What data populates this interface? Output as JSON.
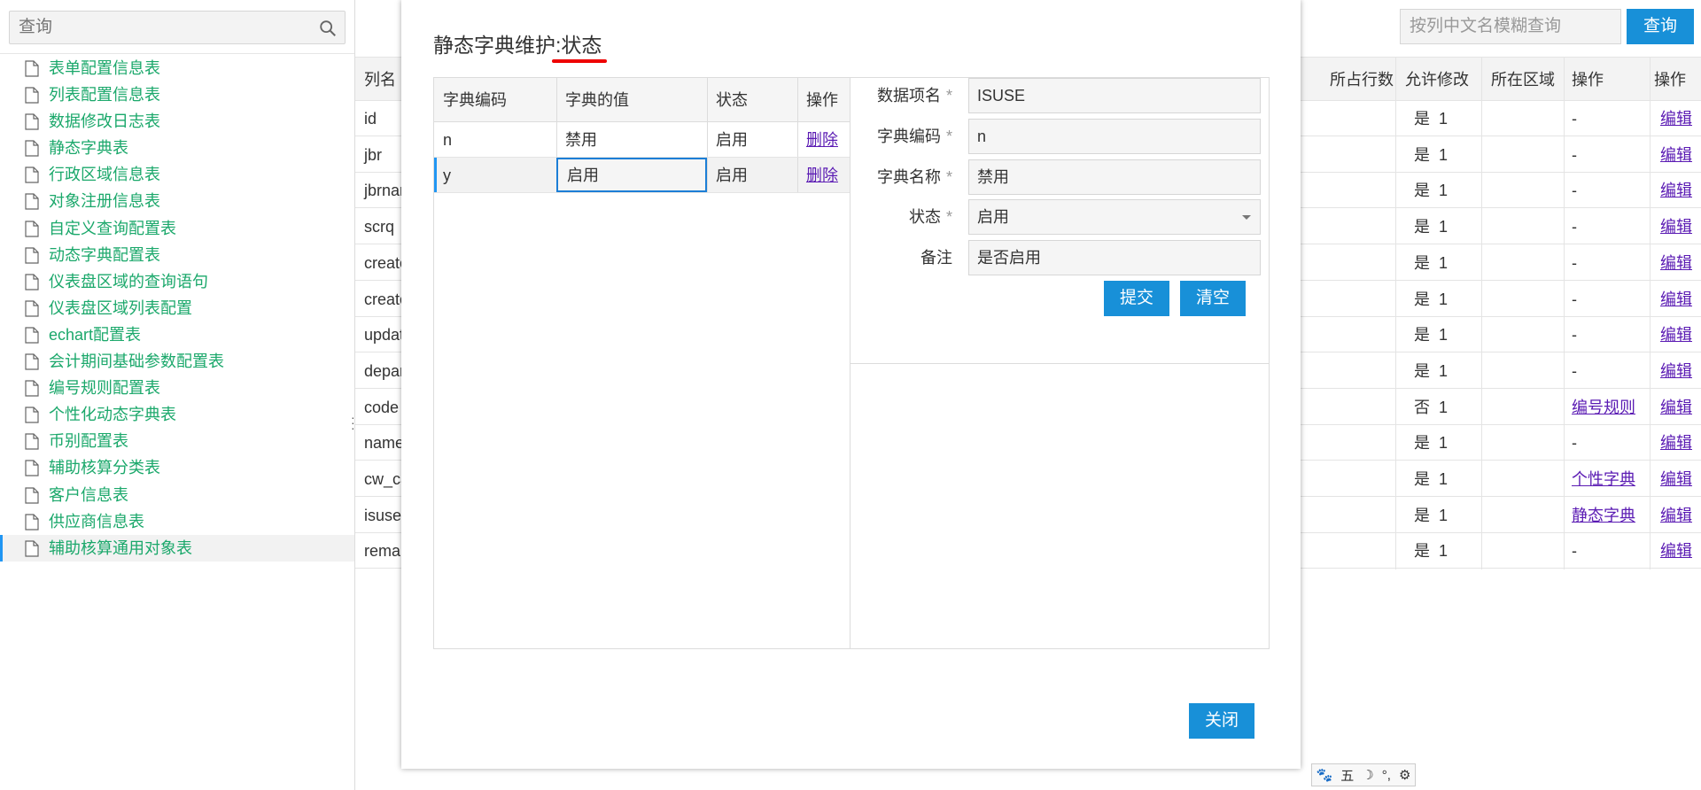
{
  "sidebar": {
    "search_placeholder": "查询",
    "items": [
      {
        "label": "表单配置信息表"
      },
      {
        "label": "列表配置信息表"
      },
      {
        "label": "数据修改日志表"
      },
      {
        "label": "静态字典表"
      },
      {
        "label": "行政区域信息表"
      },
      {
        "label": "对象注册信息表"
      },
      {
        "label": "自定义查询配置表"
      },
      {
        "label": "动态字典配置表"
      },
      {
        "label": "仪表盘区域的查询语句"
      },
      {
        "label": "仪表盘区域列表配置"
      },
      {
        "label": "echart配置表"
      },
      {
        "label": "会计期间基础参数配置表"
      },
      {
        "label": "编号规则配置表"
      },
      {
        "label": "个性化动态字典表"
      },
      {
        "label": "币别配置表"
      },
      {
        "label": "辅助核算分类表"
      },
      {
        "label": "客户信息表"
      },
      {
        "label": "供应商信息表"
      },
      {
        "label": "辅助核算通用对象表"
      }
    ],
    "selected_index": 18
  },
  "main": {
    "search_placeholder": "按列中文名模糊查询",
    "search_button": "查询",
    "headers": {
      "col_name": "列名",
      "rows": "所占行数",
      "editable": "允许修改",
      "area": "所在区域",
      "op": "操作",
      "op2": "操作"
    },
    "rows": [
      {
        "name": "id",
        "rows": "1",
        "editable": "是",
        "op": "-",
        "edit": "编辑"
      },
      {
        "name": "jbr",
        "rows": "1",
        "editable": "是",
        "op": "-",
        "edit": "编辑"
      },
      {
        "name": "jbrnar",
        "rows": "1",
        "editable": "是",
        "op": "-",
        "edit": "编辑"
      },
      {
        "name": "scrq",
        "rows": "1",
        "editable": "是",
        "op": "-",
        "edit": "编辑"
      },
      {
        "name": "creato",
        "rows": "1",
        "editable": "是",
        "op": "-",
        "edit": "编辑"
      },
      {
        "name": "creato",
        "rows": "1",
        "editable": "是",
        "op": "-",
        "edit": "编辑"
      },
      {
        "name": "updat",
        "rows": "1",
        "editable": "是",
        "op": "-",
        "edit": "编辑"
      },
      {
        "name": "depar",
        "rows": "1",
        "editable": "是",
        "op": "-",
        "edit": "编辑"
      },
      {
        "name": "code",
        "rows": "1",
        "editable": "否",
        "op": "编号规则",
        "edit": "编辑"
      },
      {
        "name": "name",
        "rows": "1",
        "editable": "是",
        "op": "-",
        "edit": "编辑"
      },
      {
        "name": "cw_ca",
        "rows": "1",
        "editable": "是",
        "op": "个性字典",
        "edit": "编辑"
      },
      {
        "name": "isuse",
        "rows": "1",
        "editable": "是",
        "op": "静态字典",
        "edit": "编辑"
      },
      {
        "name": "remar",
        "rows": "1",
        "editable": "是",
        "op": "-",
        "edit": "编辑"
      }
    ]
  },
  "modal": {
    "title_prefix": "静态字典维护:",
    "title_field": "状态",
    "grid_headers": {
      "code": "字典编码",
      "value": "字典的值",
      "status": "状态",
      "op": "操作"
    },
    "grid_rows": [
      {
        "code": "n",
        "value": "禁用",
        "status": "启用",
        "op": "删除"
      },
      {
        "code": "y",
        "value": "启用",
        "status": "启用",
        "op": "删除"
      }
    ],
    "form": {
      "item_label": "数据项名",
      "item_value": "ISUSE",
      "code_label": "字典编码",
      "code_value": "n",
      "name_label": "字典名称",
      "name_value": "禁用",
      "status_label": "状态",
      "status_value": "启用",
      "remark_label": "备注",
      "remark_value": "是否启用",
      "required_mark": "*"
    },
    "submit_button": "提交",
    "clear_button": "清空",
    "close_button": "关闭"
  },
  "ime": {
    "items": [
      "🐾",
      "五",
      "☽",
      "°,",
      "⚙"
    ]
  },
  "colors": {
    "accent": "#1890d8",
    "tree_text": "#1ba86b",
    "link": "#5a1ab3",
    "underline": "#e00000"
  }
}
